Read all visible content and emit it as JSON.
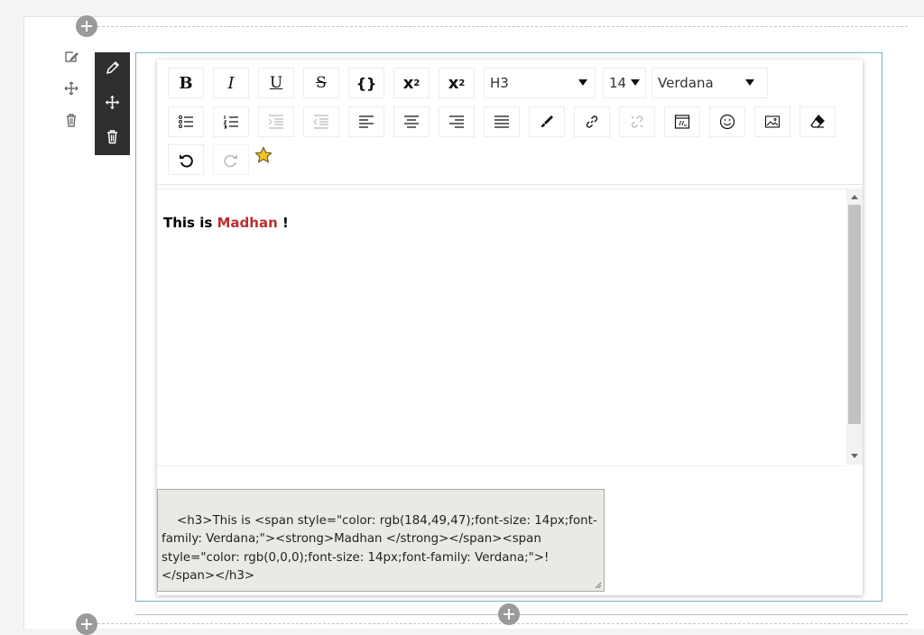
{
  "toolbar": {
    "bold": "B",
    "italic": "I",
    "underline": "U",
    "strike": "S",
    "code": "{}",
    "superscript_base": "x",
    "superscript_exp": "2",
    "subscript_base": "x",
    "subscript_sub": "2",
    "heading": {
      "selected": "H3"
    },
    "size": {
      "selected": "14"
    },
    "font": {
      "selected": "Verdana"
    }
  },
  "content": {
    "prefix": "This is ",
    "highlight": "Madhan",
    "suffix": " !",
    "highlight_color": "#b8312f"
  },
  "source": {
    "html": "<h3>This is <span style=\"color: rgb(184,49,47);font-size: 14px;font-family: Verdana;\"><strong>Madhan </strong></span><span style=\"color: rgb(0,0,0);font-size: 14px;font-family: Verdana;\">!</span></h3>"
  },
  "icons": [
    "edit-icon",
    "move-icon",
    "trash-icon",
    "add-block-icon",
    "bulleted-list-icon",
    "numbered-list-icon",
    "indent-icon",
    "outdent-icon",
    "align-left-icon",
    "align-center-icon",
    "align-right-icon",
    "justify-icon",
    "brush-icon",
    "link-icon",
    "unlink-icon",
    "embed-code-icon",
    "emoji-icon",
    "image-icon",
    "eraser-icon",
    "undo-icon",
    "redo-icon",
    "star-icon"
  ],
  "colors": {
    "accent_frame": "#7fb2c6",
    "dark_toolbar": "#2f2f2f",
    "star": "#f3c623",
    "source_bg": "#ebe9e4"
  }
}
